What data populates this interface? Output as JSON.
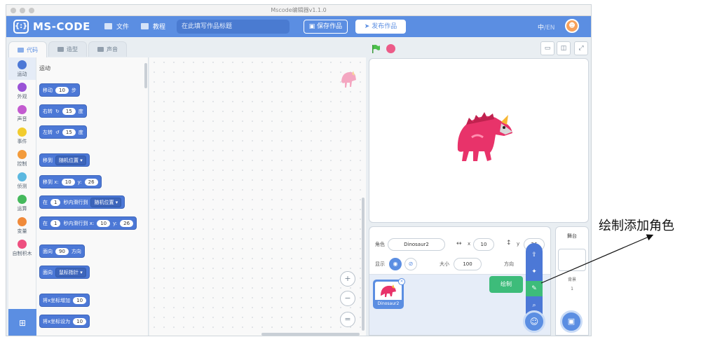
{
  "window": {
    "title": "Mscode编辑器v1.1.0"
  },
  "menubar": {
    "logo_mark": "{:}",
    "logo_text": "MS-CODE",
    "file": "文件",
    "tutorial": "教程",
    "title_placeholder": "在此填写作品标题",
    "save": "保存作品",
    "publish": "发布作品",
    "lang_zh": "中",
    "lang_sep": "/",
    "lang_en": "EN"
  },
  "tabs": [
    {
      "label": "代码"
    },
    {
      "label": "造型"
    },
    {
      "label": "声音"
    }
  ],
  "categories": [
    {
      "label": "运动",
      "color": "#4c78d6"
    },
    {
      "label": "外观",
      "color": "#9a53d6"
    },
    {
      "label": "声音",
      "color": "#c35bd0"
    },
    {
      "label": "事件",
      "color": "#f2cc2e"
    },
    {
      "label": "控制",
      "color": "#f39b3b"
    },
    {
      "label": "侦测",
      "color": "#5cb8e0"
    },
    {
      "label": "运算",
      "color": "#45b95c"
    },
    {
      "label": "变量",
      "color": "#f08a3a"
    },
    {
      "label": "自制积木",
      "color": "#ee4f7f"
    }
  ],
  "palette": {
    "title": "运动",
    "move": {
      "a": "移动",
      "v": "10",
      "b": "步"
    },
    "turn_right": {
      "a": "右转",
      "icon": "↻",
      "v": "15",
      "b": "度"
    },
    "turn_left": {
      "a": "左转",
      "icon": "↺",
      "v": "15",
      "b": "度"
    },
    "goto": {
      "a": "移到",
      "opt": "随机位置 ▾"
    },
    "goto_xy": {
      "a": "移到 x:",
      "x": "10",
      "b": "y:",
      "y": "26"
    },
    "glide": {
      "a": "在",
      "v": "1",
      "b": "秒内滑行到",
      "opt": "随机位置 ▾"
    },
    "glide_xy": {
      "a": "在",
      "v": "1",
      "b": "秒内滑行到 x:",
      "x": "10",
      "c": "y:",
      "y": "26"
    },
    "point": {
      "a": "面向",
      "v": "90",
      "b": "方向"
    },
    "point_towards": {
      "a": "面向",
      "opt": "鼠标指针 ▾"
    },
    "change_x": {
      "a": "将x坐标增加",
      "v": "10"
    },
    "set_x": {
      "a": "将x坐标设为",
      "v": "10"
    }
  },
  "zoom": {
    "in": "+",
    "out": "−",
    "reset": "="
  },
  "stage_buttons": {
    "small": "▭",
    "normal": "◫",
    "full": "⤢"
  },
  "sprite_info": {
    "name_label": "角色",
    "name": "Dinosaur2",
    "x_arrow": "↔",
    "x_label": "x",
    "x": "10",
    "y_arrow": "↕",
    "y_label": "y",
    "y": "26",
    "show_label": "显示",
    "size_label": "大小",
    "size": "100",
    "dir_label": "方向"
  },
  "sprite_list": [
    {
      "name": "Dinosaur2"
    }
  ],
  "add_menu": {
    "upload": "⇪",
    "surprise": "✦",
    "paint": "✎",
    "search": "⌕",
    "main": "☺",
    "tooltip": "绘制"
  },
  "stage_panel": {
    "title": "舞台",
    "backdrop_label": "背景",
    "backdrop_count": "1",
    "add": "▣"
  },
  "annotation": "绘制添加角色",
  "colors": {
    "brand": "#5b8ee2",
    "motion": "#4c78d6",
    "paint": "#3dbc7a",
    "dino": "#e8336a"
  }
}
